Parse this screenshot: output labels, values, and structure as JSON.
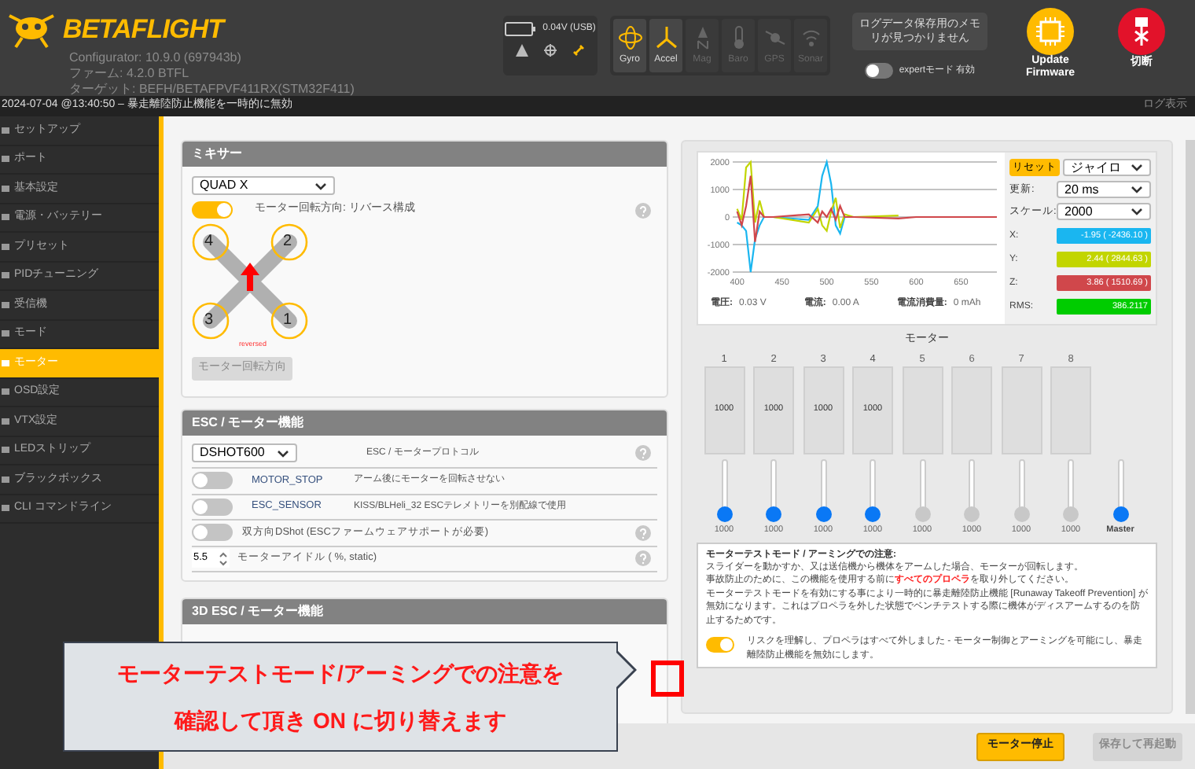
{
  "header": {
    "logo": "BETAFLIGHT",
    "version_lines": [
      "Configurator: 10.9.0 (697943b)",
      "ファーム: 4.2.0 BTFL",
      "ターゲット: BEFH/BETAFPVF411RX(STM32F411)"
    ],
    "battery": "0.04V (USB)",
    "sensors": [
      {
        "label": "Gyro",
        "kind": "gyro",
        "on": true
      },
      {
        "label": "Accel",
        "kind": "accel",
        "on": true
      },
      {
        "label": "Mag",
        "kind": "mag",
        "on": false
      },
      {
        "label": "Baro",
        "kind": "baro",
        "on": false
      },
      {
        "label": "GPS",
        "kind": "gps",
        "on": false
      },
      {
        "label": "Sonar",
        "kind": "sonar",
        "on": false
      }
    ],
    "log_button": "ログデータ保存用のメモリが見つかりません",
    "expert_mode": {
      "label": "expertモード 有効",
      "on": false
    },
    "update_firmware": "Update\nFirmware",
    "disconnect": "切断"
  },
  "status_bar": {
    "message": "2024-07-04 @13:40:50 – 暴走離陸防止機能を一時的に無効",
    "log_link": "ログ表示"
  },
  "sidebar": {
    "items": [
      {
        "label": "セットアップ",
        "selected": false
      },
      {
        "label": "ポート",
        "selected": false
      },
      {
        "label": "基本設定",
        "selected": false
      },
      {
        "label": "電源・バッテリー",
        "selected": false
      },
      {
        "label": "プリセット",
        "selected": false
      },
      {
        "label": "PIDチューニング",
        "selected": false
      },
      {
        "label": "受信機",
        "selected": false
      },
      {
        "label": "モード",
        "selected": false
      },
      {
        "label": "モーター",
        "selected": true
      },
      {
        "label": "OSD設定",
        "selected": false
      },
      {
        "label": "VTX設定",
        "selected": false
      },
      {
        "label": "LEDストリップ",
        "selected": false
      },
      {
        "label": "ブラックボックス",
        "selected": false
      },
      {
        "label": "CLI コマンドライン",
        "selected": false
      }
    ]
  },
  "mixer": {
    "title": "ミキサー",
    "mixer_type": "QUAD X",
    "reverse": {
      "label": "モーター回転方向: リバース構成",
      "on": true
    },
    "motor_numbers": [
      "4",
      "2",
      "3",
      "1"
    ],
    "reversed_label": "reversed",
    "direction_button": "モーター回転方向"
  },
  "esc": {
    "title": "ESC / モーター機能",
    "protocol": "DSHOT600",
    "protocol_label": "ESC / モータープロトコル",
    "rows": [
      {
        "kind": "toggle",
        "name": "MOTOR_STOP",
        "label": "アーム後にモーターを回転させない",
        "on": false
      },
      {
        "kind": "toggle",
        "name": "ESC_SENSOR",
        "label": "KISS/BLHeli_32 ESCテレメトリーを別配線で使用",
        "on": false
      },
      {
        "kind": "toggle",
        "label": "双方向DShot (ESCファームウェアサポートが必要)",
        "on": false,
        "help": true
      },
      {
        "kind": "number",
        "value": "5.5",
        "label": "モーターアイドル ( %, static)",
        "help": true
      }
    ]
  },
  "esc_3d": {
    "title": "3D ESC / モーター機能"
  },
  "sensor_graph": {
    "reset": "リセット",
    "sensor": "ジャイロ",
    "update_label": "更新:",
    "update": "20 ms",
    "scale_label": "スケール:",
    "scale": "2000",
    "readouts": [
      {
        "label": "X:",
        "value": "-1.95 ( -2436.10 )",
        "color": "#1ab6f0"
      },
      {
        "label": "Y:",
        "value": "2.44 ( 2844.63 )",
        "color": "#c2d500"
      },
      {
        "label": "Z:",
        "value": "3.86 ( 1510.69 )",
        "color": "#d0474b"
      },
      {
        "label": "RMS:",
        "value": "386.2117",
        "color": "#00cc00"
      }
    ],
    "power": [
      {
        "label": "電圧:",
        "value": "0.03 V"
      },
      {
        "label": "電流:",
        "value": "0.00 A"
      },
      {
        "label": "電流消費量:",
        "value": "0 mAh"
      }
    ],
    "chart_data": {
      "type": "line",
      "x": [
        400,
        405,
        410,
        415,
        420,
        425,
        430,
        440,
        480,
        490,
        495,
        500,
        505,
        510,
        515,
        520,
        530,
        580,
        600,
        650,
        690
      ],
      "xlim": [
        395,
        690
      ],
      "ylim": [
        -2000,
        2000
      ],
      "xticks": [
        400,
        450,
        500,
        550,
        600,
        650
      ],
      "yticks": [
        -2000,
        -1000,
        0,
        1000,
        2000
      ],
      "grid": true,
      "series": [
        {
          "color": "#1ab6f0",
          "values": [
            -200,
            -300,
            -500,
            -2000,
            -800,
            -300,
            0,
            0,
            -100,
            400,
            1500,
            2000,
            1200,
            -300,
            -600,
            0,
            0,
            null,
            null,
            null,
            null
          ]
        },
        {
          "color": "#c2d500",
          "values": [
            300,
            -100,
            1800,
            2000,
            -200,
            600,
            0,
            0,
            -200,
            300,
            -300,
            -500,
            200,
            700,
            -400,
            100,
            0,
            50,
            null,
            null,
            null
          ]
        },
        {
          "color": "#d0474b",
          "values": [
            200,
            -300,
            400,
            1500,
            -900,
            200,
            0,
            0,
            100,
            -200,
            200,
            0,
            300,
            -100,
            400,
            0,
            0,
            -50,
            0,
            0,
            0
          ]
        }
      ]
    }
  },
  "motors": {
    "title": "モーター",
    "channels": [
      {
        "number": "1",
        "bar_value": "1000",
        "value": "1000",
        "enabled": true,
        "level": 0
      },
      {
        "number": "2",
        "bar_value": "1000",
        "value": "1000",
        "enabled": true,
        "level": 0
      },
      {
        "number": "3",
        "bar_value": "1000",
        "value": "1000",
        "enabled": true,
        "level": 0
      },
      {
        "number": "4",
        "bar_value": "1000",
        "value": "1000",
        "enabled": true,
        "level": 0
      },
      {
        "number": "5",
        "value": "1000",
        "enabled": false,
        "level": 0
      },
      {
        "number": "6",
        "value": "1000",
        "enabled": false,
        "level": 0
      },
      {
        "number": "7",
        "value": "1000",
        "enabled": false,
        "level": 0
      },
      {
        "number": "8",
        "value": "1000",
        "enabled": false,
        "level": 0
      }
    ],
    "master": {
      "label": "Master",
      "level": 0
    }
  },
  "notice": {
    "title": "モーターテストモード / アーミングでの注意:",
    "paragraphs": [
      "スライダーを動かすか、又は送信機から機体をアームした場合、モーターが回転します。",
      "事故防止のために、この機能を使用する前に**すべてのプロペラ**を取り外してください。",
      "モーターテストモードを有効にする事により一時的に暴走離陸防止機能 [Runaway Takeoff Prevention] が無効になります。これはプロペラを外した状態でベンチテストする際に機体がディスアームするのを防止するためです。"
    ],
    "confirm": {
      "label": "リスクを理解し、プロペラはすべて外しました - モーター制御とアーミングを可能にし、暴走離陸防止機能を無効にします。",
      "on": true
    }
  },
  "buttons": {
    "stop": "モーター停止",
    "save": "保存して再起動"
  },
  "callout": {
    "lines": [
      "モーターテストモード/アーミングでの注意を",
      "確認して頂き ON に切り替えます"
    ]
  }
}
